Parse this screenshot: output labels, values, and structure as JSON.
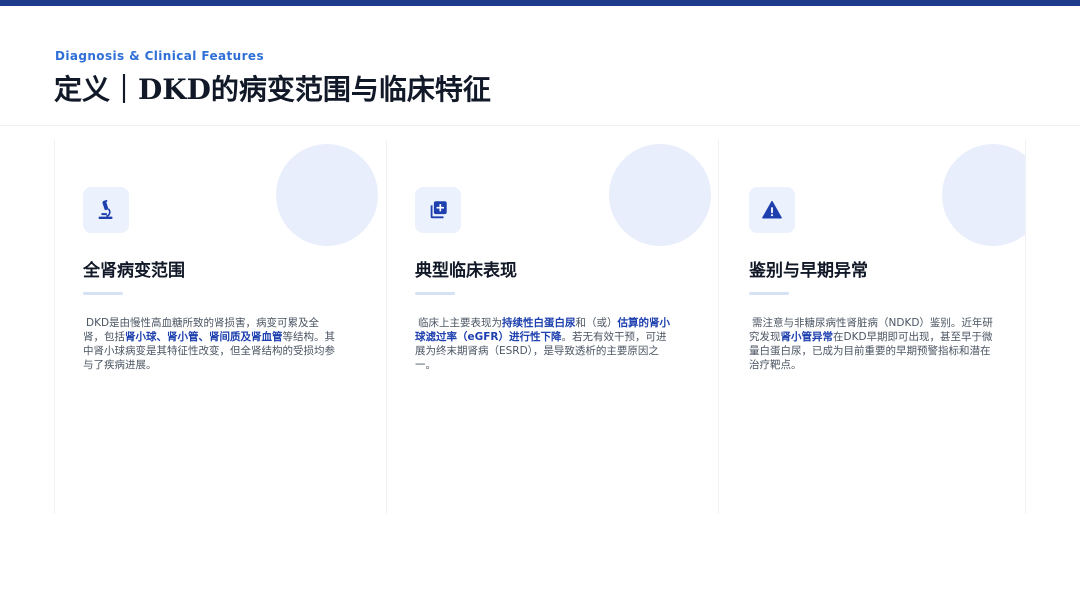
{
  "header": {
    "kicker": "Diagnosis & Clinical Features",
    "title": "定义｜DKD的病变范围与临床特征"
  },
  "colors": {
    "accent": "#1e3a8a",
    "highlight": "#1e40af",
    "kicker": "#2f6fd6",
    "circle": "#e8eefb"
  },
  "cards": [
    {
      "icon": "microscope-icon",
      "title": "全肾病变范围",
      "text": {
        "p1": "DKD是由慢性高血糖所致的肾损害，病变可累及全肾，包括",
        "h1": "肾小球、肾小管、肾间质及肾血管",
        "p2": "等结构。其中肾小球病变是其特征性改变，但全肾结构的受损均参与了疾病进展。"
      }
    },
    {
      "icon": "add-document-icon",
      "title": "典型临床表现",
      "text": {
        "p1": "临床上主要表现为",
        "h1": "持续性白蛋白尿",
        "p2": "和（或）",
        "h2": "估算的肾小球滤过率（eGFR）进行性下降",
        "p3": "。若无有效干预，可进展为终末期肾病（ESRD），是导致透析的主要原因之一。"
      }
    },
    {
      "icon": "warning-icon",
      "title": "鉴别与早期异常",
      "text": {
        "p1": "需注意与非糖尿病性肾脏病（NDKD）鉴别。近年研究发现",
        "h1": "肾小管异常",
        "p2": "在DKD早期即可出现，甚至早于微量白蛋白尿，已成为目前重要的早期预警指标和潜在治疗靶点。"
      }
    }
  ]
}
